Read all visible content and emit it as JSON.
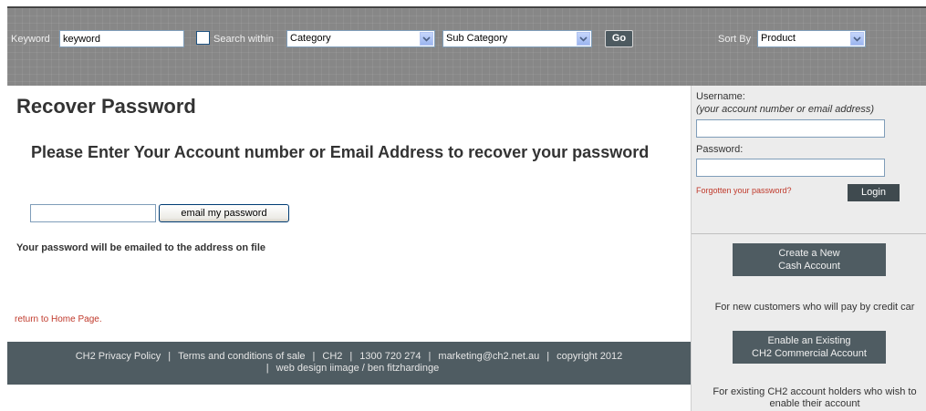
{
  "search_bar": {
    "keyword_label": "Keyword",
    "keyword_value": "keyword",
    "search_within_label": "Search within",
    "search_within_checked": false,
    "category_selected": "Category",
    "sub_category_selected": "Sub Category",
    "go_label": "Go",
    "sort_by_label": "Sort By",
    "sort_by_selected": "Product"
  },
  "main": {
    "page_title": "Recover Password",
    "subheading": "Please Enter Your Account number or Email Address to recover your password",
    "recover_input_value": "",
    "email_button_label": "email my password",
    "info_text": "Your password will be emailed to the address on file",
    "return_link": "return to Home Page."
  },
  "footer": {
    "links": [
      "CH2 Privacy Policy",
      "Terms and conditions of sale",
      "CH2",
      "1300 720 274",
      "marketing@ch2.net.au",
      "copyright 2012"
    ],
    "credit": "web design iimage / ben fitzhardinge",
    "separator": "|"
  },
  "login": {
    "username_label": "Username:",
    "username_hint": "(your account number or email address)",
    "password_label": "Password:",
    "forgot_link": "Forgotten your password?",
    "login_button": "Login"
  },
  "sidebar_cta": {
    "cash_button_line1": "Create a New",
    "cash_button_line2": "Cash Account",
    "cash_desc": "For new customers who will pay by credit car",
    "commercial_button_line1": "Enable an Existing",
    "commercial_button_line2": "CH2 Commercial Account",
    "commercial_desc_line1": "For existing CH2 account holders who wish to",
    "commercial_desc_line2": "enable their account"
  },
  "colors": {
    "topbar_bg": "#878787",
    "footer_bg": "#4f5c62",
    "link_red": "#c0392b",
    "sidebar_bg": "#ececec"
  }
}
